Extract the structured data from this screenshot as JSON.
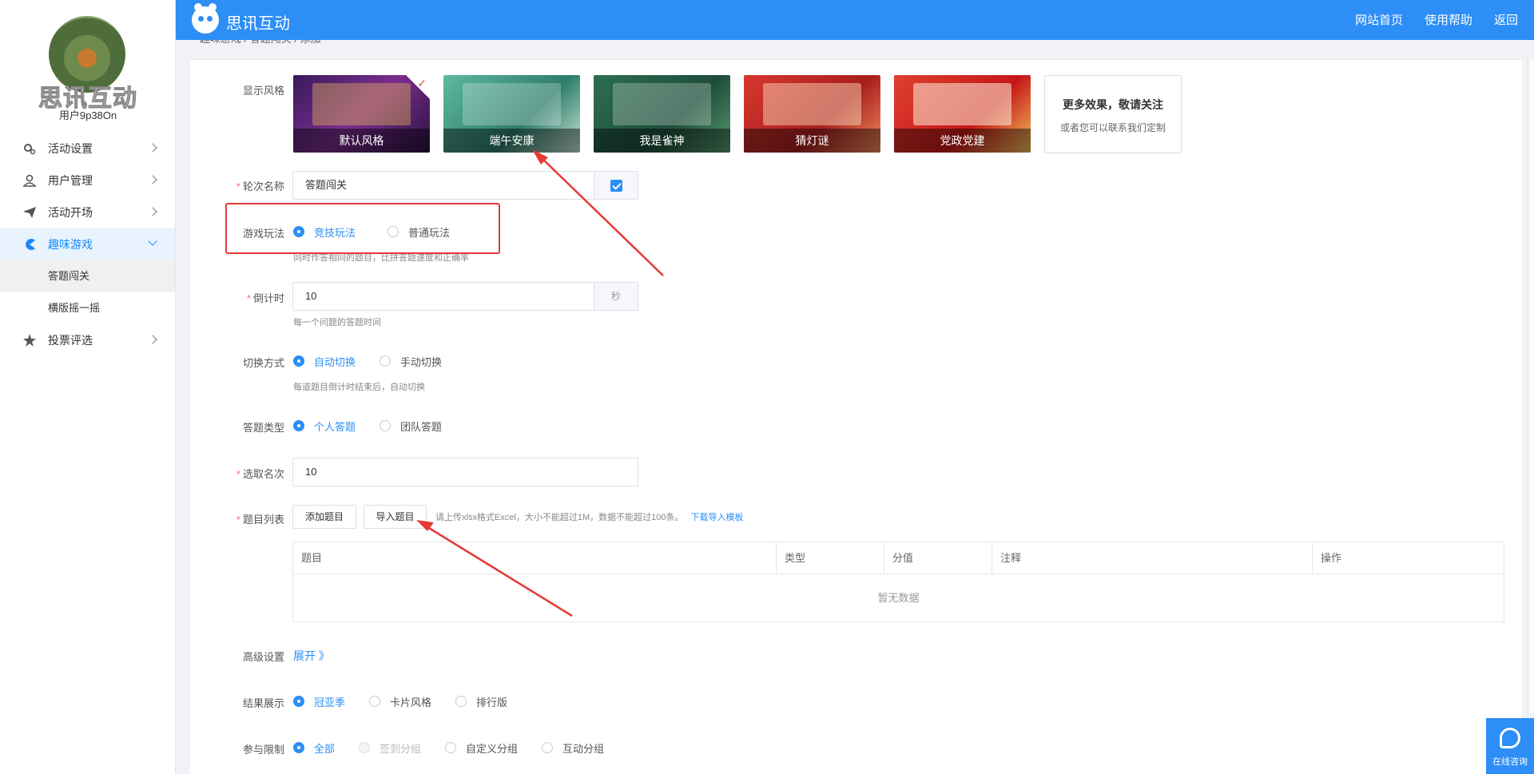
{
  "sidebar": {
    "brand_overlay": "思讯互动",
    "username": "用户9p38On",
    "menu": [
      {
        "label": "活动设置"
      },
      {
        "label": "用户管理"
      },
      {
        "label": "活动开场"
      },
      {
        "label": "趣味游戏"
      },
      {
        "label": "投票评选"
      }
    ],
    "submenu": [
      {
        "label": "答题闯关"
      },
      {
        "label": "横版摇一摇"
      }
    ]
  },
  "header": {
    "brand": "思讯互动",
    "nav": [
      "网站首页",
      "使用帮助",
      "返回"
    ]
  },
  "breadcrumb": "趣味游戏  /  答题闯关  /  添加",
  "form": {
    "style": {
      "label": "显示风格",
      "cards": [
        {
          "name": "默认风格"
        },
        {
          "name": "端午安康"
        },
        {
          "name": "我是雀神"
        },
        {
          "name": "猜灯谜"
        },
        {
          "name": "党政党建"
        }
      ],
      "more_title": "更多效果，敬请关注",
      "more_sub": "或者您可以联系我们定制"
    },
    "round_name": {
      "label": "轮次名称",
      "value": "答题闯关"
    },
    "game_mode": {
      "label": "游戏玩法",
      "options": [
        "竞技玩法",
        "普通玩法"
      ],
      "hint": "同时作答相同的题目，比拼答题速度和正确率"
    },
    "countdown": {
      "label": "倒计时",
      "value": "10",
      "unit": "秒",
      "hint": "每一个问题的答题时间"
    },
    "switch_mode": {
      "label": "切换方式",
      "options": [
        "自动切换",
        "手动切换"
      ],
      "hint": "每道题目倒计时结束后，自动切换"
    },
    "answer_type": {
      "label": "答题类型",
      "options": [
        "个人答题",
        "团队答题"
      ]
    },
    "pick_count": {
      "label": "选取名次",
      "value": "10"
    },
    "question_list": {
      "label": "题目列表",
      "add_button": "添加题目",
      "import_button": "导入题目",
      "upload_hint": "请上传xlsx格式Excel，大小不能超过1M，数据不能超过100条。",
      "template_link": "下载导入模板",
      "columns": [
        "题目",
        "类型",
        "分值",
        "注释",
        "操作"
      ],
      "empty_text": "暂无数据"
    },
    "advanced": {
      "label": "高级设置",
      "toggle": "展开 》"
    },
    "result_display": {
      "label": "结果展示",
      "options": [
        "冠亚季",
        "卡片风格",
        "排行版"
      ]
    },
    "participation": {
      "label": "参与限制",
      "options": [
        "全部",
        "签到分组",
        "自定义分组",
        "互动分组"
      ]
    }
  },
  "chat_widget": {
    "label": "在线咨询"
  },
  "colors": {
    "primary": "#2c8ef6",
    "highlight": "#e53935"
  }
}
